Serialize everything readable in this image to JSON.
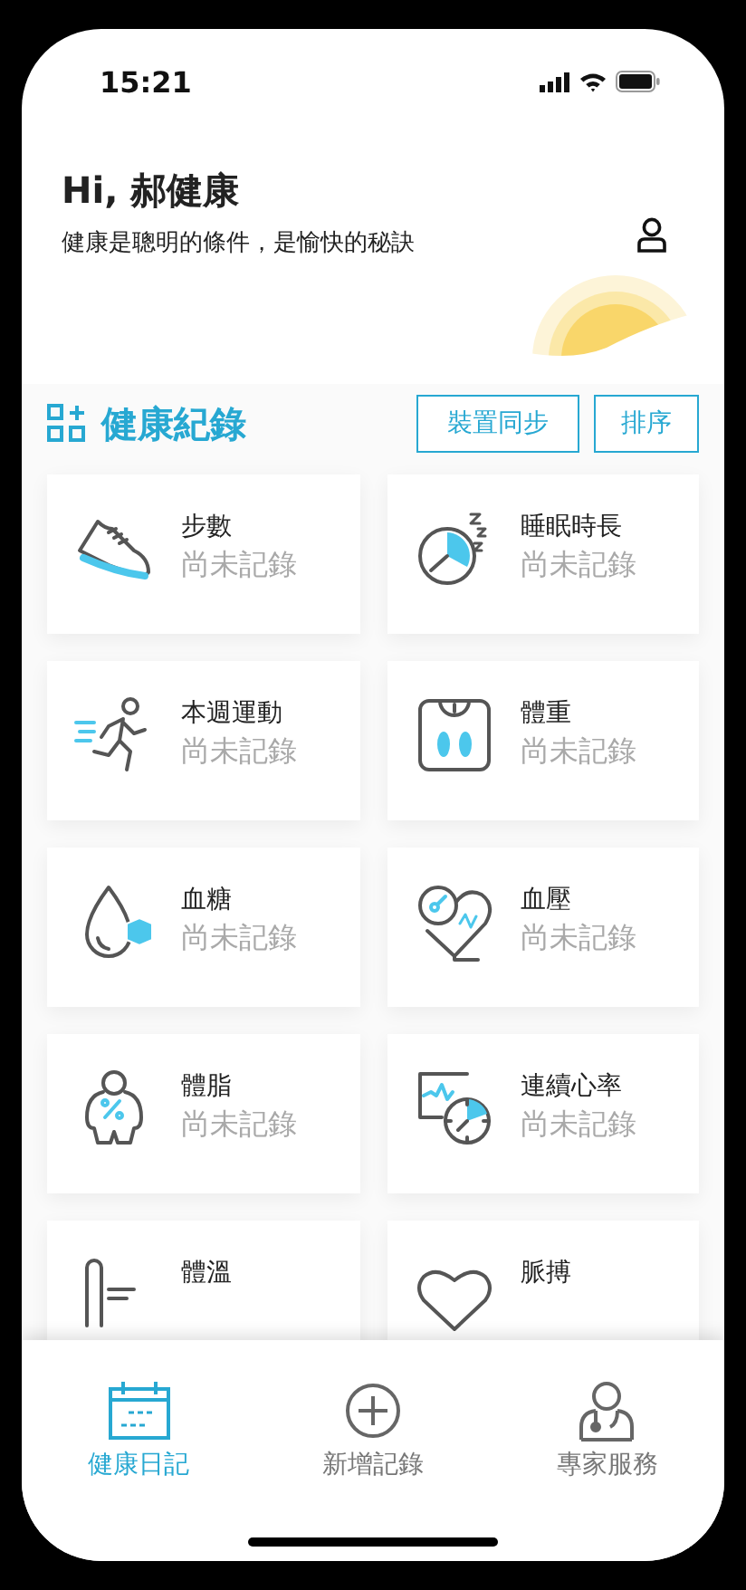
{
  "status_bar": {
    "time": "15:21"
  },
  "header": {
    "greeting": "Hi, 郝健康",
    "motto": "健康是聰明的條件，是愉快的秘訣"
  },
  "section": {
    "title": "健康紀錄",
    "buttons": [
      "裝置同步",
      "排序"
    ]
  },
  "records": [
    {
      "kind": "shoe",
      "name": "步數",
      "value": "尚未記錄"
    },
    {
      "kind": "sleep",
      "name": "睡眠時長",
      "value": "尚未記錄"
    },
    {
      "kind": "runner",
      "name": "本週運動",
      "value": "尚未記錄"
    },
    {
      "kind": "scale",
      "name": "體重",
      "value": "尚未記錄"
    },
    {
      "kind": "drop",
      "name": "血糖",
      "value": "尚未記錄"
    },
    {
      "kind": "pressure",
      "name": "血壓",
      "value": "尚未記錄"
    },
    {
      "kind": "body",
      "name": "體脂",
      "value": "尚未記錄"
    },
    {
      "kind": "monitor",
      "name": "連續心率",
      "value": "尚未記錄"
    },
    {
      "kind": "thermometer",
      "name": "體溫"
    },
    {
      "kind": "heart",
      "name": "脈搏"
    }
  ],
  "tabs": [
    {
      "kind": "calendar",
      "label": "健康日記",
      "selected": true
    },
    {
      "kind": "plus",
      "label": "新增記錄",
      "selected": false
    },
    {
      "kind": "doctor",
      "label": "專家服務",
      "selected": false
    }
  ]
}
